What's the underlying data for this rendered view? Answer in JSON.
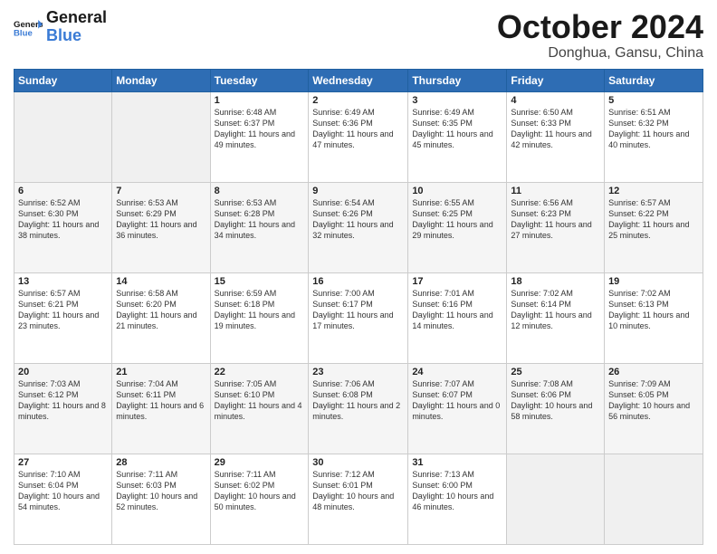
{
  "logo": {
    "line1": "General",
    "line2": "Blue",
    "icon": "▶"
  },
  "header": {
    "month": "October 2024",
    "location": "Donghua, Gansu, China"
  },
  "weekdays": [
    "Sunday",
    "Monday",
    "Tuesday",
    "Wednesday",
    "Thursday",
    "Friday",
    "Saturday"
  ],
  "weeks": [
    [
      null,
      null,
      {
        "day": "1",
        "sunrise": "Sunrise: 6:48 AM",
        "sunset": "Sunset: 6:37 PM",
        "daylight": "Daylight: 11 hours and 49 minutes."
      },
      {
        "day": "2",
        "sunrise": "Sunrise: 6:49 AM",
        "sunset": "Sunset: 6:36 PM",
        "daylight": "Daylight: 11 hours and 47 minutes."
      },
      {
        "day": "3",
        "sunrise": "Sunrise: 6:49 AM",
        "sunset": "Sunset: 6:35 PM",
        "daylight": "Daylight: 11 hours and 45 minutes."
      },
      {
        "day": "4",
        "sunrise": "Sunrise: 6:50 AM",
        "sunset": "Sunset: 6:33 PM",
        "daylight": "Daylight: 11 hours and 42 minutes."
      },
      {
        "day": "5",
        "sunrise": "Sunrise: 6:51 AM",
        "sunset": "Sunset: 6:32 PM",
        "daylight": "Daylight: 11 hours and 40 minutes."
      }
    ],
    [
      {
        "day": "6",
        "sunrise": "Sunrise: 6:52 AM",
        "sunset": "Sunset: 6:30 PM",
        "daylight": "Daylight: 11 hours and 38 minutes."
      },
      {
        "day": "7",
        "sunrise": "Sunrise: 6:53 AM",
        "sunset": "Sunset: 6:29 PM",
        "daylight": "Daylight: 11 hours and 36 minutes."
      },
      {
        "day": "8",
        "sunrise": "Sunrise: 6:53 AM",
        "sunset": "Sunset: 6:28 PM",
        "daylight": "Daylight: 11 hours and 34 minutes."
      },
      {
        "day": "9",
        "sunrise": "Sunrise: 6:54 AM",
        "sunset": "Sunset: 6:26 PM",
        "daylight": "Daylight: 11 hours and 32 minutes."
      },
      {
        "day": "10",
        "sunrise": "Sunrise: 6:55 AM",
        "sunset": "Sunset: 6:25 PM",
        "daylight": "Daylight: 11 hours and 29 minutes."
      },
      {
        "day": "11",
        "sunrise": "Sunrise: 6:56 AM",
        "sunset": "Sunset: 6:23 PM",
        "daylight": "Daylight: 11 hours and 27 minutes."
      },
      {
        "day": "12",
        "sunrise": "Sunrise: 6:57 AM",
        "sunset": "Sunset: 6:22 PM",
        "daylight": "Daylight: 11 hours and 25 minutes."
      }
    ],
    [
      {
        "day": "13",
        "sunrise": "Sunrise: 6:57 AM",
        "sunset": "Sunset: 6:21 PM",
        "daylight": "Daylight: 11 hours and 23 minutes."
      },
      {
        "day": "14",
        "sunrise": "Sunrise: 6:58 AM",
        "sunset": "Sunset: 6:20 PM",
        "daylight": "Daylight: 11 hours and 21 minutes."
      },
      {
        "day": "15",
        "sunrise": "Sunrise: 6:59 AM",
        "sunset": "Sunset: 6:18 PM",
        "daylight": "Daylight: 11 hours and 19 minutes."
      },
      {
        "day": "16",
        "sunrise": "Sunrise: 7:00 AM",
        "sunset": "Sunset: 6:17 PM",
        "daylight": "Daylight: 11 hours and 17 minutes."
      },
      {
        "day": "17",
        "sunrise": "Sunrise: 7:01 AM",
        "sunset": "Sunset: 6:16 PM",
        "daylight": "Daylight: 11 hours and 14 minutes."
      },
      {
        "day": "18",
        "sunrise": "Sunrise: 7:02 AM",
        "sunset": "Sunset: 6:14 PM",
        "daylight": "Daylight: 11 hours and 12 minutes."
      },
      {
        "day": "19",
        "sunrise": "Sunrise: 7:02 AM",
        "sunset": "Sunset: 6:13 PM",
        "daylight": "Daylight: 11 hours and 10 minutes."
      }
    ],
    [
      {
        "day": "20",
        "sunrise": "Sunrise: 7:03 AM",
        "sunset": "Sunset: 6:12 PM",
        "daylight": "Daylight: 11 hours and 8 minutes."
      },
      {
        "day": "21",
        "sunrise": "Sunrise: 7:04 AM",
        "sunset": "Sunset: 6:11 PM",
        "daylight": "Daylight: 11 hours and 6 minutes."
      },
      {
        "day": "22",
        "sunrise": "Sunrise: 7:05 AM",
        "sunset": "Sunset: 6:10 PM",
        "daylight": "Daylight: 11 hours and 4 minutes."
      },
      {
        "day": "23",
        "sunrise": "Sunrise: 7:06 AM",
        "sunset": "Sunset: 6:08 PM",
        "daylight": "Daylight: 11 hours and 2 minutes."
      },
      {
        "day": "24",
        "sunrise": "Sunrise: 7:07 AM",
        "sunset": "Sunset: 6:07 PM",
        "daylight": "Daylight: 11 hours and 0 minutes."
      },
      {
        "day": "25",
        "sunrise": "Sunrise: 7:08 AM",
        "sunset": "Sunset: 6:06 PM",
        "daylight": "Daylight: 10 hours and 58 minutes."
      },
      {
        "day": "26",
        "sunrise": "Sunrise: 7:09 AM",
        "sunset": "Sunset: 6:05 PM",
        "daylight": "Daylight: 10 hours and 56 minutes."
      }
    ],
    [
      {
        "day": "27",
        "sunrise": "Sunrise: 7:10 AM",
        "sunset": "Sunset: 6:04 PM",
        "daylight": "Daylight: 10 hours and 54 minutes."
      },
      {
        "day": "28",
        "sunrise": "Sunrise: 7:11 AM",
        "sunset": "Sunset: 6:03 PM",
        "daylight": "Daylight: 10 hours and 52 minutes."
      },
      {
        "day": "29",
        "sunrise": "Sunrise: 7:11 AM",
        "sunset": "Sunset: 6:02 PM",
        "daylight": "Daylight: 10 hours and 50 minutes."
      },
      {
        "day": "30",
        "sunrise": "Sunrise: 7:12 AM",
        "sunset": "Sunset: 6:01 PM",
        "daylight": "Daylight: 10 hours and 48 minutes."
      },
      {
        "day": "31",
        "sunrise": "Sunrise: 7:13 AM",
        "sunset": "Sunset: 6:00 PM",
        "daylight": "Daylight: 10 hours and 46 minutes."
      },
      null,
      null
    ]
  ]
}
